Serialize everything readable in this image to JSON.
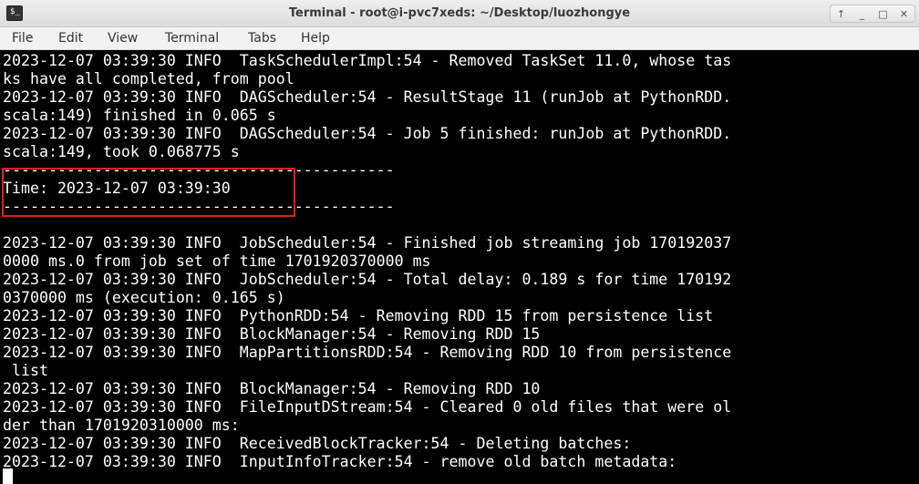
{
  "window": {
    "title": "Terminal - root@i-pvc7xeds: ~/Desktop/luozhongye",
    "controls": {
      "pin": "↑",
      "minimize": "_",
      "maximize": "□",
      "close": "✕"
    }
  },
  "menubar": {
    "items": [
      "File",
      "Edit",
      "View",
      "Terminal",
      "Tabs",
      "Help"
    ]
  },
  "terminal": {
    "lines": [
      "2023-12-07 03:39:30 INFO  TaskSchedulerImpl:54 - Removed TaskSet 11.0, whose tas",
      "ks have all completed, from pool",
      "2023-12-07 03:39:30 INFO  DAGScheduler:54 - ResultStage 11 (runJob at PythonRDD.",
      "scala:149) finished in 0.065 s",
      "2023-12-07 03:39:30 INFO  DAGScheduler:54 - Job 5 finished: runJob at PythonRDD.",
      "scala:149, took 0.068775 s",
      "-------------------------------------------",
      "Time: 2023-12-07 03:39:30",
      "-------------------------------------------",
      "",
      "2023-12-07 03:39:30 INFO  JobScheduler:54 - Finished job streaming job 170192037",
      "0000 ms.0 from job set of time 1701920370000 ms",
      "2023-12-07 03:39:30 INFO  JobScheduler:54 - Total delay: 0.189 s for time 170192",
      "0370000 ms (execution: 0.165 s)",
      "2023-12-07 03:39:30 INFO  PythonRDD:54 - Removing RDD 15 from persistence list",
      "2023-12-07 03:39:30 INFO  BlockManager:54 - Removing RDD 15",
      "2023-12-07 03:39:30 INFO  MapPartitionsRDD:54 - Removing RDD 10 from persistence",
      " list",
      "2023-12-07 03:39:30 INFO  BlockManager:54 - Removing RDD 10",
      "2023-12-07 03:39:30 INFO  FileInputDStream:54 - Cleared 0 old files that were ol",
      "der than 1701920310000 ms:",
      "2023-12-07 03:39:30 INFO  ReceivedBlockTracker:54 - Deleting batches:",
      "2023-12-07 03:39:30 INFO  InputInfoTracker:54 - remove old batch metadata:"
    ]
  },
  "colors": {
    "terminal_bg": "#000000",
    "terminal_fg": "#ffffff",
    "highlight": "#e02020"
  },
  "icons": {
    "app": "terminal-icon",
    "pin": "pin-icon",
    "minimize": "minimize-icon",
    "maximize": "maximize-icon",
    "close": "close-icon"
  }
}
